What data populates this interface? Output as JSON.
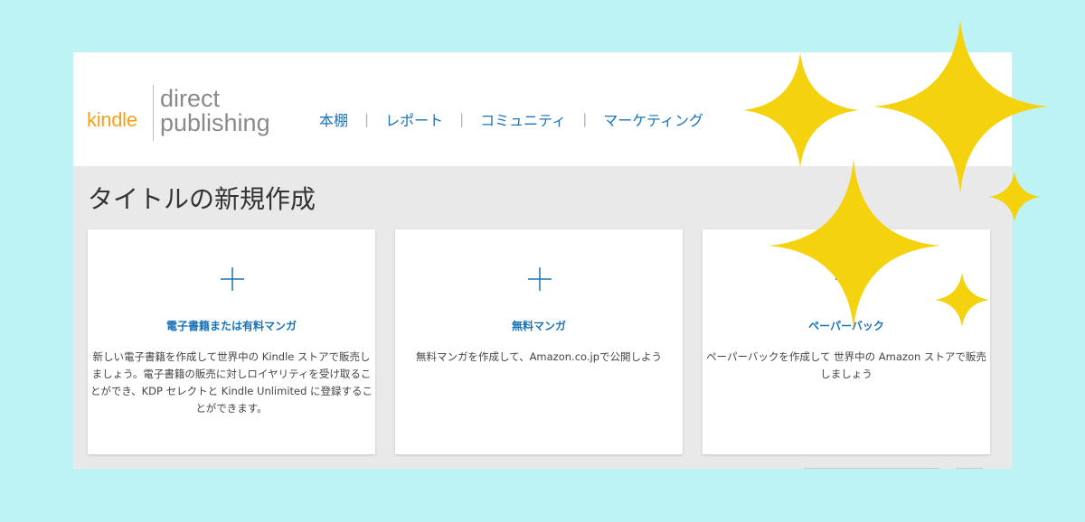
{
  "logo": {
    "kindle": "kindle",
    "line1": "direct",
    "line2": "publishing"
  },
  "nav": {
    "items": [
      "本棚",
      "レポート",
      "コミュニティ",
      "マーケティング"
    ],
    "separator": "|"
  },
  "page_title": "タイトルの新規作成",
  "cards": [
    {
      "title": "電子書籍または有料マンガ",
      "description": "新しい電子書籍を作成して世界中の Kindle ストアで販売しましょう。電子書籍の販売に対しロイヤリティを受け取ることができ、KDP セレクトと Kindle Unlimited に登録することができます。"
    },
    {
      "title": "無料マンガ",
      "description": "無料マンガを作成して、Amazon.co.jpで公開しよう"
    },
    {
      "title": "ペーパーバック",
      "description": "ペーパーバックを作成して 世界中の Amazon ストアで販売しましょう"
    }
  ],
  "colors": {
    "background": "#bdf3f4",
    "link": "#1a73b8",
    "kindle_orange": "#f7a11a",
    "sparkle": "#f4d20d"
  },
  "icons": [
    "plus-icon",
    "sparkle-icon"
  ]
}
